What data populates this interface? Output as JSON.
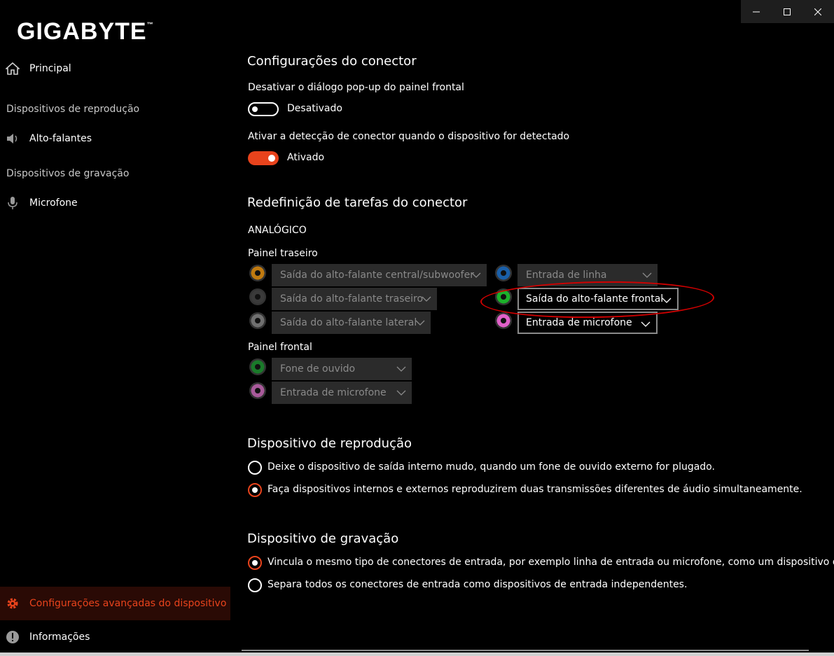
{
  "window": {
    "controls": [
      "minimize",
      "maximize",
      "close"
    ]
  },
  "sidebar": {
    "logo": "GIGABYTE",
    "logo_tm": "™",
    "items": {
      "home": {
        "label": "Principal",
        "icon": "home-icon"
      },
      "playback_header": "Dispositivos de reprodução",
      "speakers": {
        "label": "Alto-falantes",
        "icon": "speaker-icon"
      },
      "recording_header": "Dispositivos de gravação",
      "microphone": {
        "label": "Microfone",
        "icon": "microphone-icon"
      },
      "advanced": {
        "label": "Configurações avançadas do dispositivo",
        "icon": "gear-icon"
      },
      "info": {
        "label": "Informações",
        "icon": "info-icon"
      }
    }
  },
  "connector_settings": {
    "title": "Configurações do conector",
    "popup_label": "Desativar o diálogo pop-up do painel frontal",
    "popup_state": "Desativado",
    "detect_label": "Ativar a detecção de conector quando o dispositivo for detectado",
    "detect_state": "Ativado"
  },
  "retasking": {
    "title": "Redefinição de tarefas do conector",
    "analog": "ANALÓGICO",
    "rear_panel": "Painel traseiro",
    "front_panel": "Painel frontal",
    "rear_left": [
      {
        "label": "Saída do alto-falante central/subwoofer",
        "jack_color": "#c07a10"
      },
      {
        "label": "Saída do alto-falante traseiro",
        "jack_color": "#3a3a3a"
      },
      {
        "label": "Saída do alto-falante lateral",
        "jack_color": "#707070"
      }
    ],
    "rear_right": [
      {
        "label": "Entrada de linha",
        "jack_color": "#1a5fa8"
      },
      {
        "label": "Saída do alto-falante frontal",
        "jack_color": "#1cb02a"
      },
      {
        "label": "Entrada de microfone",
        "jack_color": "#e060c8"
      }
    ],
    "front": [
      {
        "label": "Fone de ouvido",
        "jack_color": "#1a7a2a"
      },
      {
        "label": "Entrada de microfone",
        "jack_color": "#a85a9a"
      }
    ]
  },
  "playback_device": {
    "title": "Dispositivo de reprodução",
    "option1": "Deixe o dispositivo de saída interno mudo, quando um fone de ouvido externo for plugado.",
    "option2": "Faça dispositivos internos e externos reproduzirem duas transmissões diferentes de áudio simultaneamente.",
    "selected": 2
  },
  "recording_device": {
    "title": "Dispositivo de gravação",
    "option1": "Vincula o mesmo tipo de conectores de entrada, por exemplo linha de entrada ou microfone, como um dispositivo de entr",
    "option2": "Separa todos os conectores de entrada como dispositivos de entrada independentes.",
    "selected": 1
  },
  "colors": {
    "accent": "#e8431c",
    "annotation": "#d10000"
  }
}
